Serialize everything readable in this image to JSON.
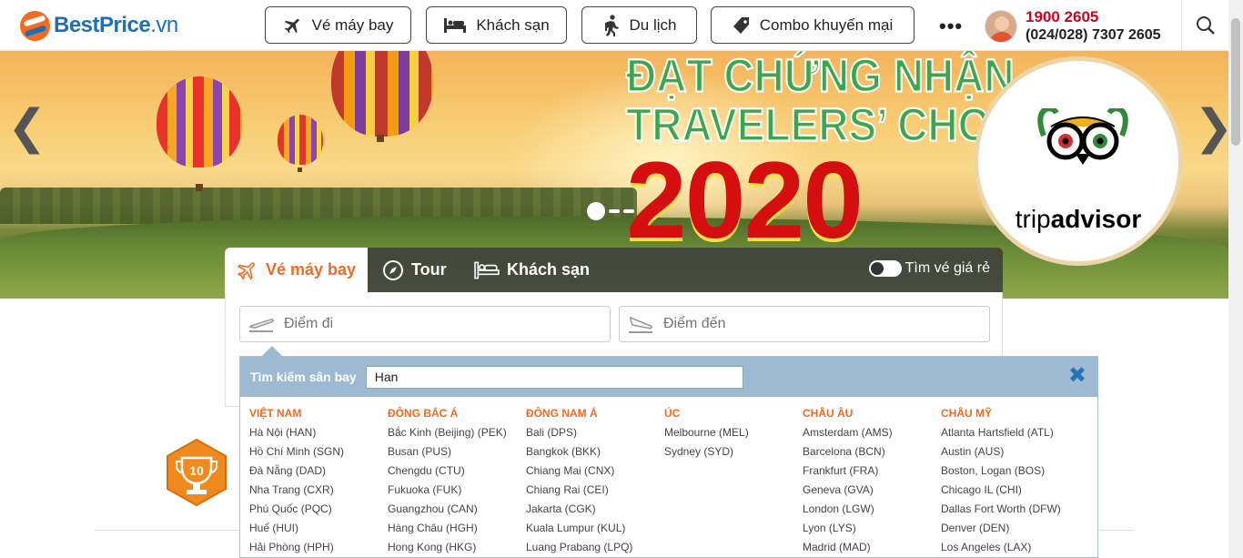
{
  "brand": {
    "name": "BestPrice",
    "domain": ".vn"
  },
  "nav": [
    {
      "label": "Vé máy bay",
      "icon": "airplane-icon"
    },
    {
      "label": "Khách sạn",
      "icon": "bed-icon"
    },
    {
      "label": "Du lịch",
      "icon": "hiker-icon"
    },
    {
      "label": "Combo khuyến mại",
      "icon": "tag-icon"
    }
  ],
  "more_label": "•••",
  "hotline": {
    "primary": "1900 2605",
    "secondary": "(024/028) 7307 2605"
  },
  "hero": {
    "title_line1": "ĐẠT CHỨNG NHẬN",
    "title_line2": "TRAVELERS’ CHOICE",
    "year": "2020",
    "badge_text_1": "trip",
    "badge_text_2": "advisor",
    "prev_arrow": "❮",
    "next_arrow": "❯"
  },
  "search_widget": {
    "tabs": [
      {
        "label": "Vé máy bay",
        "icon": "airplane-icon"
      },
      {
        "label": "Tour",
        "icon": "compass-icon"
      },
      {
        "label": "Khách sạn",
        "icon": "bed-icon"
      }
    ],
    "toggle_label": "Tìm vé giá rẻ",
    "from_placeholder": "Điểm đi",
    "to_placeholder": "Điểm đến"
  },
  "airport_dropdown": {
    "label": "Tìm kiếm sân bay",
    "query": "Han",
    "close_symbol": "✖",
    "regions": [
      {
        "name": "Việt Nam",
        "airports": [
          "Hà Nội (HAN)",
          "Hồ Chí Minh (SGN)",
          "Đà Nẵng (DAD)",
          "Nha Trang (CXR)",
          "Phú Quốc (PQC)",
          "Huế (HUI)",
          "Hải Phòng (HPH)"
        ]
      },
      {
        "name": "Đông Bắc Á",
        "airports": [
          "Bắc Kinh (Beijing) (PEK)",
          "Busan (PUS)",
          "Chengdu (CTU)",
          "Fukuoka (FUK)",
          "Guangzhou (CAN)",
          "Hàng Châu (HGH)",
          "Hong Kong (HKG)"
        ]
      },
      {
        "name": "Đông Nam Á",
        "airports": [
          "Bali (DPS)",
          "Bangkok (BKK)",
          "Chiang Mai (CNX)",
          "Chiang Rai (CEI)",
          "Jakarta (CGK)",
          "Kuala Lumpur (KUL)",
          "Luang Prabang (LPQ)"
        ]
      },
      {
        "name": "Úc",
        "airports": [
          "Melbourne (MEL)",
          "Sydney (SYD)"
        ]
      },
      {
        "name": "Châu Âu",
        "airports": [
          "Amsterdam (AMS)",
          "Barcelona (BCN)",
          "Frankfurt (FRA)",
          "Geneva (GVA)",
          "London (LGW)",
          "Lyon (LYS)",
          "Madrid (MAD)"
        ]
      },
      {
        "name": "Châu Mỹ",
        "airports": [
          "Atlanta Hartsfield (ATL)",
          "Austin (AUS)",
          "Boston, Logan (BOS)",
          "Chicago IL (CHI)",
          "Dallas Fort Worth (DFW)",
          "Denver (DEN)",
          "Los Angeles (LAX)"
        ]
      }
    ]
  },
  "award_badge": {
    "number": "10"
  },
  "colors": {
    "brand_orange": "#f26b21",
    "brand_blue": "#1d6fb8",
    "hotline_red": "#d0021b",
    "dropdown_header": "#9dbad2",
    "close_blue": "#2672b5"
  }
}
